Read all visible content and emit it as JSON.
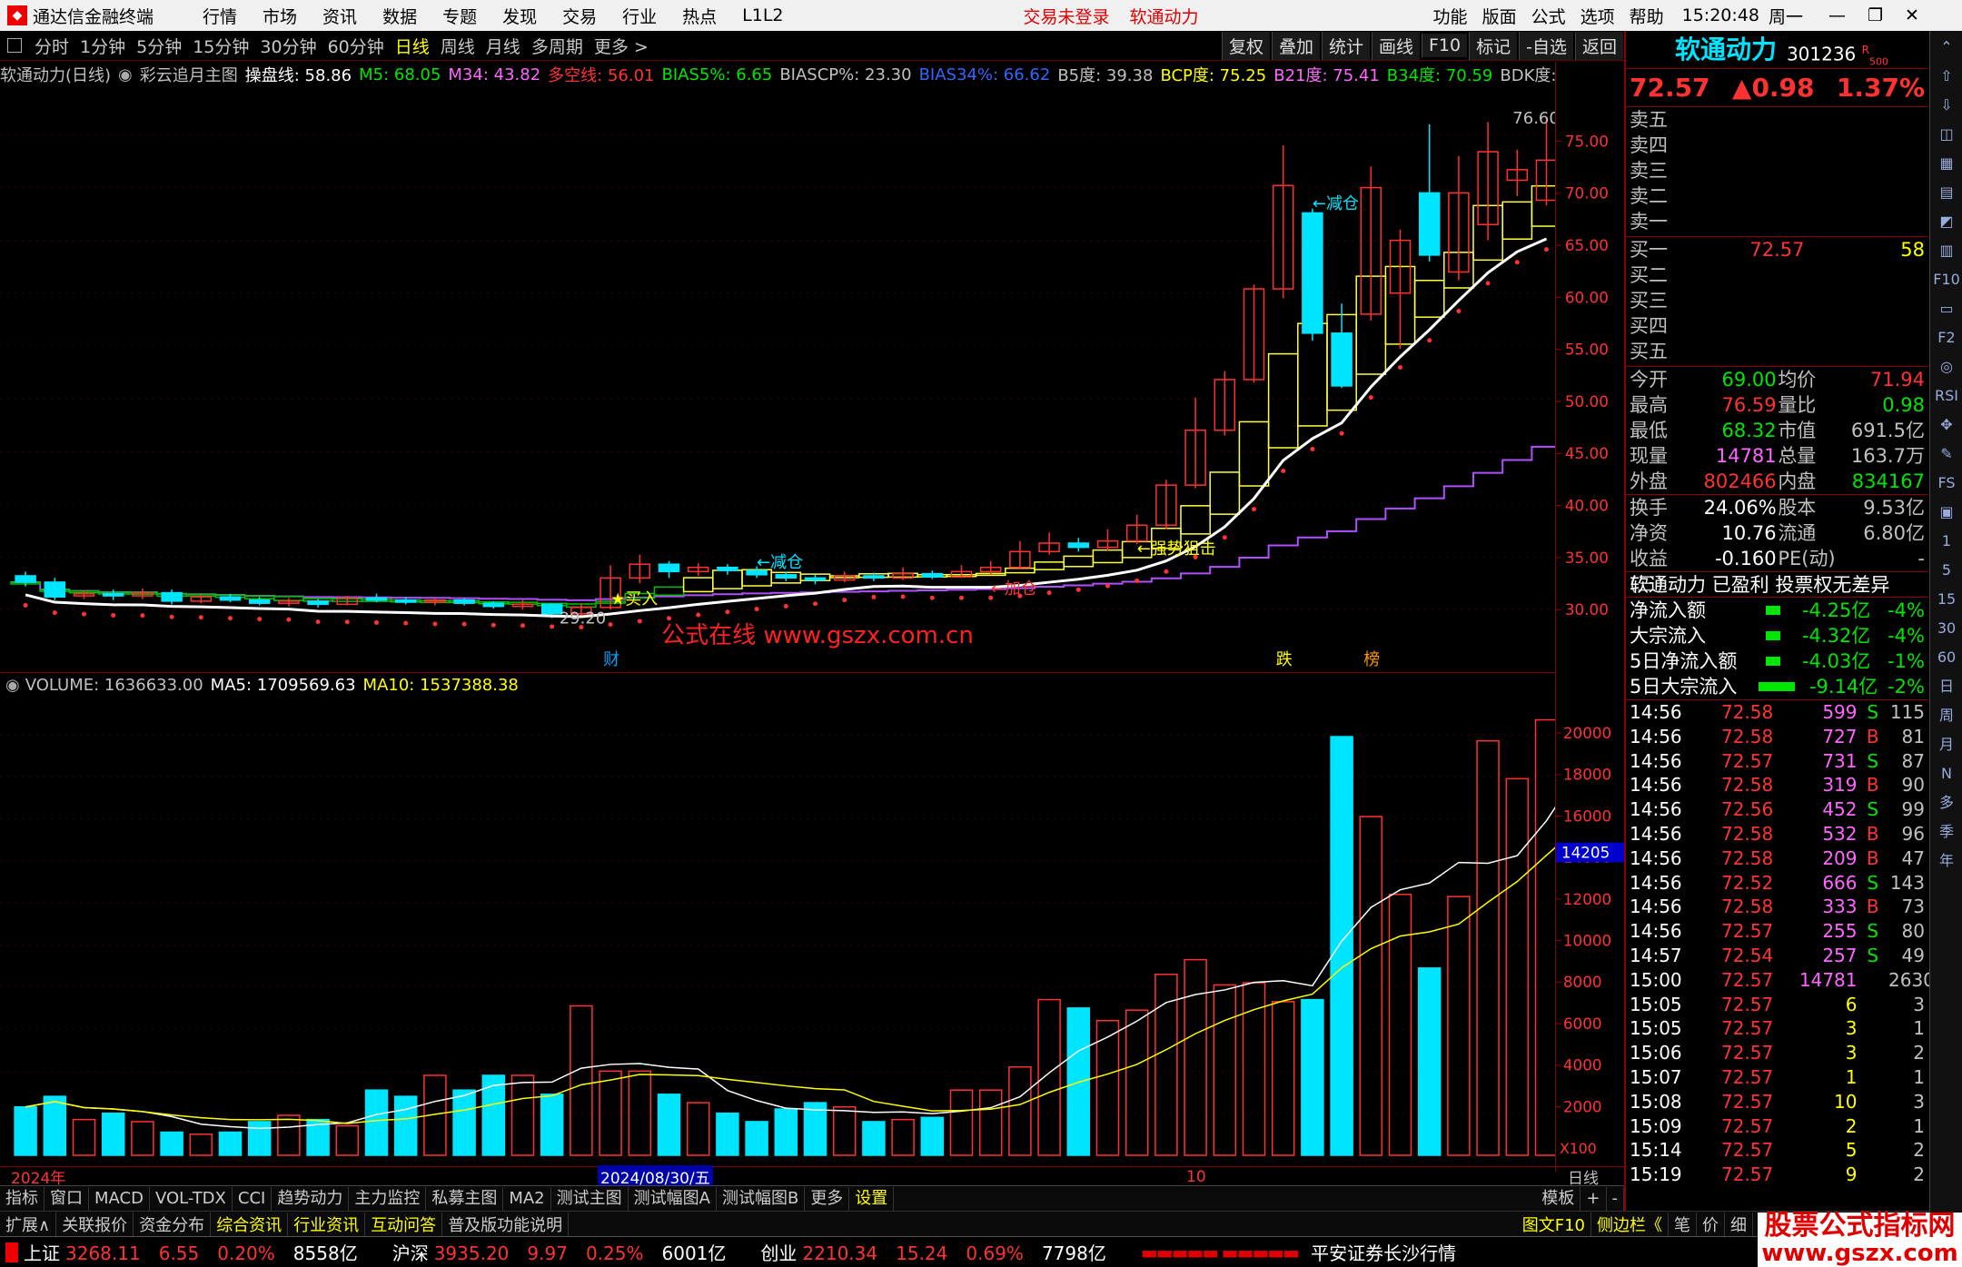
{
  "titlebar": {
    "app_title": "通达信金融终端",
    "menus": [
      "行情",
      "市场",
      "资讯",
      "数据",
      "专题",
      "发现",
      "交易",
      "行业",
      "热点",
      "L1L2"
    ],
    "login_status": "交易未登录",
    "stock_name": "软通动力",
    "right_menus": [
      "功能",
      "版面",
      "公式",
      "选项",
      "帮助"
    ],
    "clock": "15:20:48",
    "weekday": "周一"
  },
  "periodbar": {
    "items": [
      "分时",
      "1分钟",
      "5分钟",
      "15分钟",
      "30分钟",
      "60分钟",
      "日线",
      "周线",
      "月线",
      "多周期",
      "更多 >"
    ],
    "active": "日线",
    "tools": [
      "复权",
      "叠加",
      "统计",
      "画线",
      "F10",
      "标记",
      "-自选",
      "返回"
    ]
  },
  "indicator_line": {
    "name": "软通动力(日线)",
    "formula": "彩云追月主图",
    "items": [
      {
        "label": "操盘线: 58.86",
        "color": "#ffffff"
      },
      {
        "label": "M5: 68.05",
        "color": "#00e600"
      },
      {
        "label": "M34: 43.82",
        "color": "#ff66ff"
      },
      {
        "label": "多空线: 56.01",
        "color": "#ff3232"
      },
      {
        "label": "BIAS5%: 6.65",
        "color": "#00e600"
      },
      {
        "label": "BIASCP%: 23.30",
        "color": "#c0c0c0"
      },
      {
        "label": "BIAS34%: 66.62",
        "color": "#3366ff"
      },
      {
        "label": "B5度: 39.38",
        "color": "#c0c0c0"
      },
      {
        "label": "BCP度: 75.25",
        "color": "#ffff00"
      },
      {
        "label": "B21度: 75.41",
        "color": "#ff66ff"
      },
      {
        "label": "B34度: 70.59",
        "color": "#00e600"
      },
      {
        "label": "BDK度: 70.5",
        "color": "#c0c0c0"
      }
    ]
  },
  "chart_data": [
    {
      "type": "candlestick",
      "title": "软通动力(日线)",
      "yticks": [
        "75.00",
        "70.00",
        "65.00",
        "60.00",
        "55.00",
        "50.00",
        "45.00",
        "40.00",
        "35.00",
        "30.00"
      ],
      "ylim": [
        27,
        79
      ],
      "annotations": [
        "76.60",
        "29.20",
        "←减仓",
        "←减仓",
        "★买入",
        "←加仓",
        "←强势狙击"
      ],
      "markers": [
        "财",
        "跌",
        "榜"
      ],
      "watermark": "公式在线  www.gszx.com.cn",
      "candles": [
        {
          "o": 33.2,
          "c": 32.6,
          "h": 33.6,
          "l": 32.2
        },
        {
          "o": 32.6,
          "c": 31.2,
          "h": 33.0,
          "l": 30.9
        },
        {
          "o": 31.3,
          "c": 31.5,
          "h": 31.8,
          "l": 31.0
        },
        {
          "o": 31.5,
          "c": 31.3,
          "h": 31.9,
          "l": 30.9
        },
        {
          "o": 31.3,
          "c": 31.6,
          "h": 32.0,
          "l": 31.0
        },
        {
          "o": 31.6,
          "c": 30.8,
          "h": 31.9,
          "l": 30.5
        },
        {
          "o": 30.8,
          "c": 31.2,
          "h": 31.4,
          "l": 30.6
        },
        {
          "o": 31.2,
          "c": 30.9,
          "h": 31.5,
          "l": 30.7
        },
        {
          "o": 30.9,
          "c": 30.6,
          "h": 31.2,
          "l": 30.4
        },
        {
          "o": 30.6,
          "c": 30.8,
          "h": 31.1,
          "l": 30.3
        },
        {
          "o": 30.8,
          "c": 30.5,
          "h": 31.0,
          "l": 30.2
        },
        {
          "o": 30.5,
          "c": 31.1,
          "h": 31.3,
          "l": 30.4
        },
        {
          "o": 31.1,
          "c": 30.9,
          "h": 31.5,
          "l": 30.7
        },
        {
          "o": 30.9,
          "c": 30.7,
          "h": 31.2,
          "l": 30.5
        },
        {
          "o": 30.7,
          "c": 30.9,
          "h": 31.1,
          "l": 30.4
        },
        {
          "o": 30.9,
          "c": 30.6,
          "h": 31.1,
          "l": 30.4
        },
        {
          "o": 30.6,
          "c": 30.3,
          "h": 30.8,
          "l": 30.1
        },
        {
          "o": 30.3,
          "c": 30.5,
          "h": 30.9,
          "l": 30.0
        },
        {
          "o": 30.5,
          "c": 29.6,
          "h": 30.6,
          "l": 29.2
        },
        {
          "o": 29.6,
          "c": 30.2,
          "h": 30.6,
          "l": 29.4
        },
        {
          "o": 30.2,
          "c": 33.0,
          "h": 34.2,
          "l": 30.0
        },
        {
          "o": 33.0,
          "c": 34.3,
          "h": 35.2,
          "l": 32.5
        },
        {
          "o": 34.3,
          "c": 33.6,
          "h": 34.6,
          "l": 33.0
        },
        {
          "o": 33.6,
          "c": 34.0,
          "h": 34.4,
          "l": 33.2
        },
        {
          "o": 34.0,
          "c": 33.7,
          "h": 34.3,
          "l": 33.3
        },
        {
          "o": 33.7,
          "c": 33.3,
          "h": 34.1,
          "l": 33.0
        },
        {
          "o": 33.3,
          "c": 33.0,
          "h": 33.6,
          "l": 32.7
        },
        {
          "o": 33.0,
          "c": 32.8,
          "h": 33.3,
          "l": 32.4
        },
        {
          "o": 32.8,
          "c": 33.2,
          "h": 33.6,
          "l": 32.6
        },
        {
          "o": 33.2,
          "c": 33.0,
          "h": 33.5,
          "l": 32.7
        },
        {
          "o": 33.0,
          "c": 33.4,
          "h": 34.0,
          "l": 32.8
        },
        {
          "o": 33.4,
          "c": 33.1,
          "h": 33.7,
          "l": 32.9
        },
        {
          "o": 33.1,
          "c": 33.6,
          "h": 34.2,
          "l": 33.0
        },
        {
          "o": 33.6,
          "c": 34.0,
          "h": 34.6,
          "l": 33.3
        },
        {
          "o": 34.0,
          "c": 35.5,
          "h": 36.5,
          "l": 33.8
        },
        {
          "o": 35.5,
          "c": 36.3,
          "h": 37.3,
          "l": 35.2
        },
        {
          "o": 36.3,
          "c": 35.9,
          "h": 36.8,
          "l": 35.5
        },
        {
          "o": 35.9,
          "c": 36.5,
          "h": 37.6,
          "l": 35.6
        },
        {
          "o": 36.5,
          "c": 38.0,
          "h": 39.0,
          "l": 36.2
        },
        {
          "o": 38.0,
          "c": 41.8,
          "h": 42.3,
          "l": 37.6
        },
        {
          "o": 41.8,
          "c": 47.0,
          "h": 50.1,
          "l": 41.5
        },
        {
          "o": 47.0,
          "c": 51.8,
          "h": 52.6,
          "l": 46.5
        },
        {
          "o": 51.8,
          "c": 60.4,
          "h": 60.8,
          "l": 51.5
        },
        {
          "o": 60.4,
          "c": 70.2,
          "h": 74.0,
          "l": 59.5
        },
        {
          "o": 67.6,
          "c": 56.2,
          "h": 68.0,
          "l": 55.5
        },
        {
          "o": 56.2,
          "c": 51.2,
          "h": 59.0,
          "l": 51.0
        },
        {
          "o": 58.0,
          "c": 70.0,
          "h": 72.0,
          "l": 57.4
        },
        {
          "o": 60.0,
          "c": 65.0,
          "h": 66.0,
          "l": 54.7
        },
        {
          "o": 69.5,
          "c": 63.6,
          "h": 76.0,
          "l": 63.0
        },
        {
          "o": 62.0,
          "c": 69.5,
          "h": 73.0,
          "l": 61.2
        },
        {
          "o": 66.5,
          "c": 73.4,
          "h": 76.2,
          "l": 65.0
        },
        {
          "o": 70.7,
          "c": 71.7,
          "h": 73.6,
          "l": 69.2
        },
        {
          "o": 68.8,
          "c": 72.6,
          "h": 76.6,
          "l": 68.3
        }
      ]
    },
    {
      "type": "bar",
      "title": "VOLUME",
      "legend": [
        {
          "label": "VOLUME: 1636633.00",
          "color": "#c0c0c0"
        },
        {
          "label": "MA5: 1709569.63",
          "color": "#ffffff"
        },
        {
          "label": "MA10: 1537388.38",
          "color": "#ffff00"
        }
      ],
      "yticks": [
        "20000",
        "18000",
        "16000",
        "14000",
        "12000",
        "10000",
        "8000",
        "6000",
        "4000",
        "2000"
      ],
      "ylim": [
        0,
        21500
      ],
      "unit": "X100",
      "current_marker": "14205",
      "values": [
        2300,
        2800,
        1700,
        2000,
        1600,
        1100,
        1000,
        1100,
        1600,
        1900,
        1700,
        1400,
        3100,
        2800,
        3800,
        3100,
        3800,
        3800,
        2900,
        7100,
        4000,
        4000,
        2900,
        2500,
        2000,
        1600,
        2200,
        2500,
        2300,
        1600,
        1700,
        1800,
        3100,
        3100,
        4200,
        7400,
        7000,
        6400,
        6900,
        8600,
        9300,
        8100,
        8200,
        7300,
        7400,
        19900,
        16100,
        12400,
        8900,
        12300,
        19700,
        17900,
        20700,
        19500,
        16200,
        16900
      ]
    },
    {
      "type": "table",
      "title": "分时成交",
      "columns": [
        "时间",
        "价格",
        "成交量",
        "方向",
        "笔数"
      ],
      "rows": [
        [
          "14:56",
          "72.58",
          "599",
          "S",
          "115"
        ],
        [
          "14:56",
          "72.58",
          "727",
          "B",
          "81"
        ],
        [
          "14:56",
          "72.57",
          "731",
          "S",
          "87"
        ],
        [
          "14:56",
          "72.58",
          "319",
          "B",
          "90"
        ],
        [
          "14:56",
          "72.56",
          "452",
          "S",
          "99"
        ],
        [
          "14:56",
          "72.58",
          "532",
          "B",
          "96"
        ],
        [
          "14:56",
          "72.58",
          "209",
          "B",
          "47"
        ],
        [
          "14:56",
          "72.52",
          "666",
          "S",
          "143"
        ],
        [
          "14:56",
          "72.58",
          "333",
          "B",
          "73"
        ],
        [
          "14:56",
          "72.57",
          "255",
          "S",
          "80"
        ],
        [
          "14:57",
          "72.54",
          "257",
          "S",
          "49"
        ],
        [
          "15:00",
          "72.57",
          "14781",
          "",
          "2630"
        ],
        [
          "15:05",
          "72.57",
          "6",
          "",
          "3"
        ],
        [
          "15:05",
          "72.57",
          "3",
          "",
          "1"
        ],
        [
          "15:06",
          "72.57",
          "3",
          "",
          "2"
        ],
        [
          "15:07",
          "72.57",
          "1",
          "",
          "1"
        ],
        [
          "15:08",
          "72.57",
          "10",
          "",
          "3"
        ],
        [
          "15:09",
          "72.57",
          "2",
          "",
          "1"
        ],
        [
          "15:14",
          "72.57",
          "5",
          "",
          "2"
        ],
        [
          "15:19",
          "72.57",
          "9",
          "",
          "2"
        ]
      ]
    }
  ],
  "xaxis": {
    "labels": [
      "2024年",
      "2024/08/30/五",
      "10"
    ],
    "right_label": "日线"
  },
  "quote": {
    "name": "软通动力",
    "code": "301236",
    "badge": "R",
    "badge2": "500",
    "price": "72.57",
    "change": "▲0.98",
    "pct": "1.37%",
    "asks": [
      "卖五",
      "卖四",
      "卖三",
      "卖二",
      "卖一"
    ],
    "bids": [
      {
        "label": "买一",
        "price": "72.57",
        "vol": "58"
      },
      {
        "label": "买二",
        "price": "",
        "vol": ""
      },
      {
        "label": "买三",
        "price": "",
        "vol": ""
      },
      {
        "label": "买四",
        "price": "",
        "vol": ""
      },
      {
        "label": "买五",
        "price": "",
        "vol": ""
      }
    ],
    "stats": [
      [
        {
          "k": "今开",
          "v": "69.00",
          "c": "grn"
        },
        {
          "k": "均价",
          "v": "71.94",
          "c": "red"
        }
      ],
      [
        {
          "k": "最高",
          "v": "76.59",
          "c": "red"
        },
        {
          "k": "量比",
          "v": "0.98",
          "c": "grn"
        }
      ],
      [
        {
          "k": "最低",
          "v": "68.32",
          "c": "grn"
        },
        {
          "k": "市值",
          "v": "691.5亿",
          "c": "gry"
        }
      ],
      [
        {
          "k": "现量",
          "v": "14781",
          "c": "mag"
        },
        {
          "k": "总量",
          "v": "163.7万",
          "c": "gry"
        }
      ],
      [
        {
          "k": "外盘",
          "v": "802466",
          "c": "red"
        },
        {
          "k": "内盘",
          "v": "834167",
          "c": "grn"
        }
      ]
    ],
    "stats2": [
      [
        {
          "k": "换手",
          "v": "24.06%",
          "c": "wht"
        },
        {
          "k": "股本",
          "v": "9.53亿",
          "c": "gry"
        }
      ],
      [
        {
          "k": "净资",
          "v": "10.76",
          "c": "wht"
        },
        {
          "k": "流通",
          "v": "6.80亿",
          "c": "gry"
        }
      ],
      [
        {
          "k": "收益(三)",
          "v": "-0.160",
          "c": "wht"
        },
        {
          "k": "PE(动)",
          "v": "-",
          "c": "gry"
        }
      ]
    ],
    "status_line": "软通动力  已盈利  投票权无差异",
    "flows": [
      {
        "k": "净流入额",
        "v": "-4.25亿",
        "p": "-4%"
      },
      {
        "k": "大宗流入",
        "v": "-4.32亿",
        "p": "-4%"
      },
      {
        "k": "5日净流入额",
        "v": "-4.03亿",
        "p": "-1%"
      },
      {
        "k": "5日大宗流入",
        "v": "-9.14亿",
        "p": "-2%"
      }
    ]
  },
  "bottomtabs": [
    "指标",
    "窗口",
    "MACD",
    "VOL-TDX",
    "CCI",
    "趋势动力",
    "主力监控",
    "私募主图",
    "MA2",
    "测试主图",
    "测试幅图A",
    "测试幅图B",
    "更多",
    "设置"
  ],
  "bottomtabs_right": [
    "模板",
    "+",
    "-"
  ],
  "bottomtabs2": [
    "扩展∧",
    "关联报价",
    "资金分布",
    "综合资讯",
    "行业资讯",
    "互动问答",
    "普及版功能说明"
  ],
  "bottomtabs2_right": [
    "图文F10",
    "侧边栏《",
    "笔",
    "价",
    "细"
  ],
  "statusbar": {
    "items": [
      {
        "name": "上证",
        "val": "3268.11",
        "chg": "6.55",
        "pct": "0.20%",
        "amt": "8558亿"
      },
      {
        "name": "沪深",
        "val": "3935.20",
        "chg": "9.97",
        "pct": "0.25%",
        "amt": "6001亿"
      },
      {
        "name": "创业",
        "val": "2210.34",
        "chg": "15.24",
        "pct": "0.69%",
        "amt": "7798亿"
      }
    ],
    "broker": "平安证券长沙行情"
  },
  "side_tools": [
    "⌃",
    "⇧",
    "⇩",
    "◫",
    "▦",
    "▤",
    "◩",
    "▥",
    "F10",
    "▭",
    "F2",
    "◎",
    "RSI",
    "✥",
    "✎",
    "FS",
    "▣",
    "1",
    "5",
    "15",
    "30",
    "60",
    "日",
    "周",
    "月",
    "N",
    "多",
    "季",
    "年"
  ],
  "watermark_site": {
    "line1": "股票公式指标网",
    "line2": "www.gszx.com"
  }
}
